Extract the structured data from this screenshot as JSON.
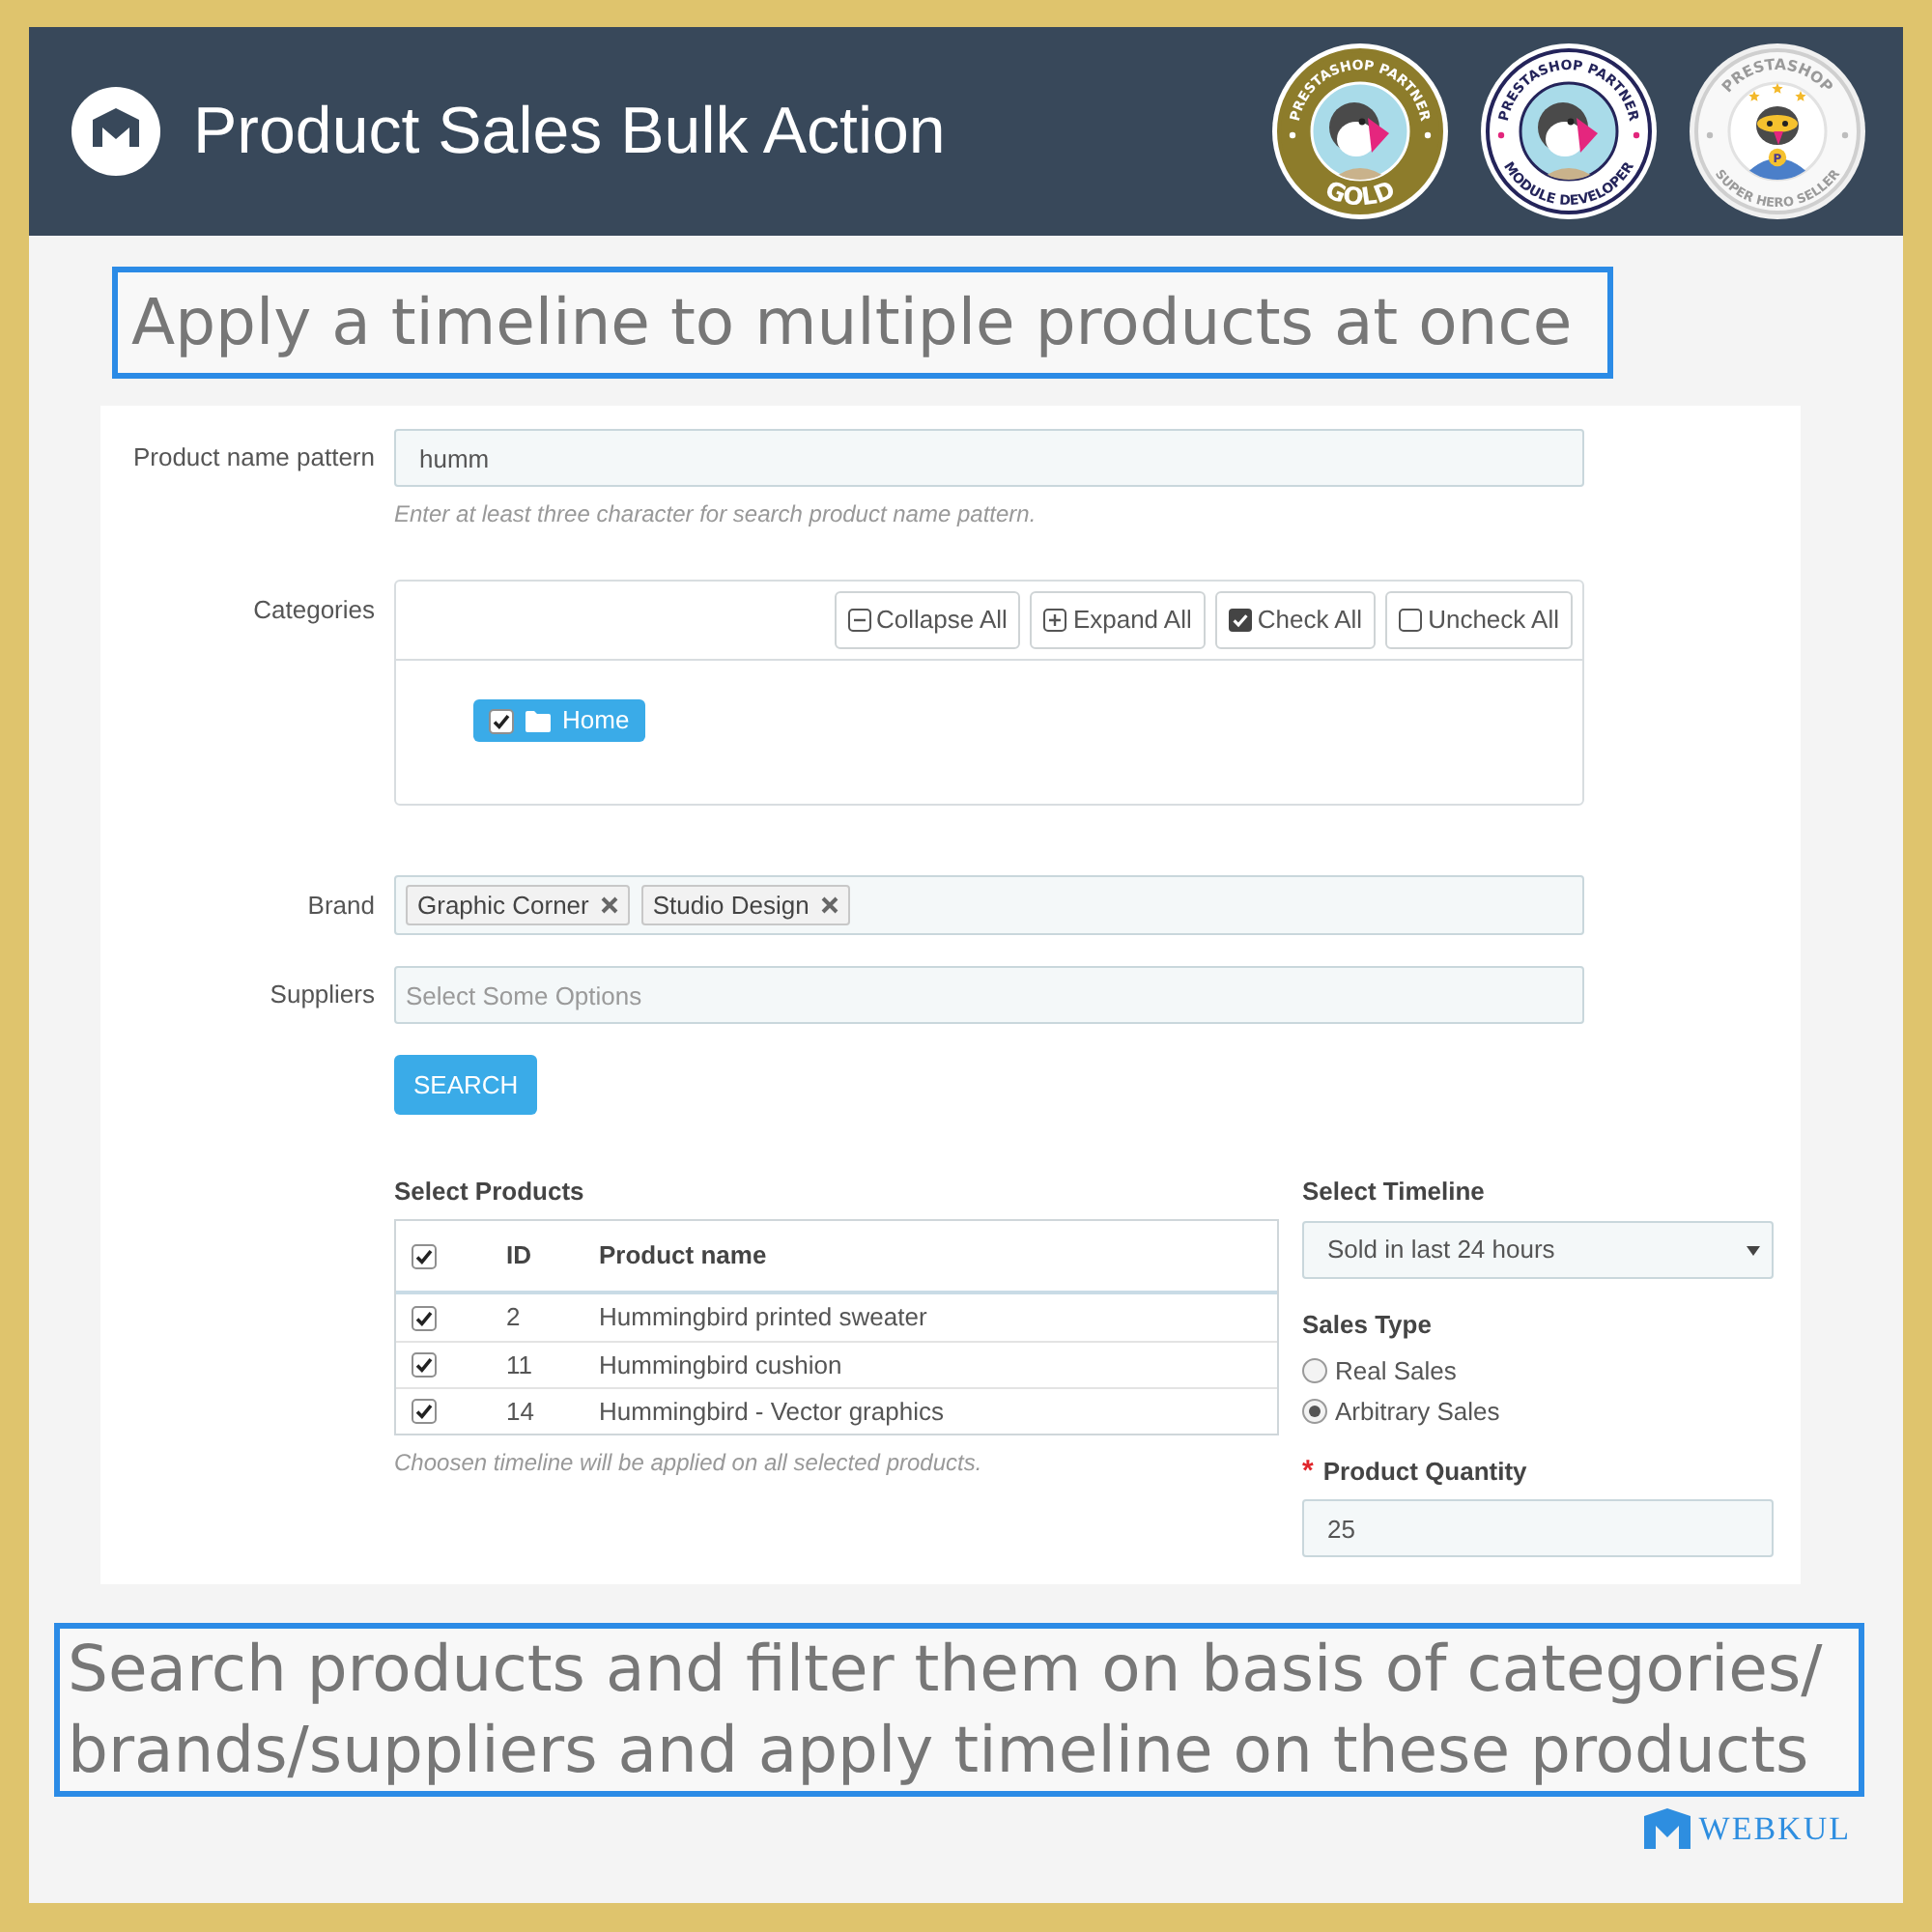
{
  "header": {
    "title": "Product Sales Bulk Action",
    "badges": [
      {
        "kind": "gold",
        "top_text": "PRESTASHOP PARTNER",
        "bottom_text": "GOLD"
      },
      {
        "kind": "developer",
        "top_text": "PRESTASHOP PARTNER",
        "bottom_text": "MODULE DEVELOPER"
      },
      {
        "kind": "hero",
        "top_text": "PRESTASHOP",
        "bottom_text": "SUPER HERO SELLER",
        "emblem": "P"
      }
    ]
  },
  "caption_top": {
    "text": "Apply a timeline to multiple products at once"
  },
  "form": {
    "product_name_pattern": {
      "label": "Product name pattern",
      "value": "humm",
      "help": "Enter at least three character for search product name pattern."
    },
    "categories": {
      "label": "Categories",
      "toolbar": [
        {
          "kind": "collapse",
          "label": "Collapse All"
        },
        {
          "kind": "expand",
          "label": "Expand All"
        },
        {
          "kind": "check",
          "label": "Check All"
        },
        {
          "kind": "uncheck",
          "label": "Uncheck All"
        }
      ],
      "tree": [
        {
          "label": "Home",
          "checked": true
        }
      ]
    },
    "brand": {
      "label": "Brand",
      "tags": [
        "Graphic Corner",
        "Studio Design"
      ]
    },
    "suppliers": {
      "label": "Suppliers",
      "placeholder": "Select Some Options"
    },
    "search_button": {
      "label": "SEARCH"
    },
    "products": {
      "heading": "Select Products",
      "all_checked": true,
      "columns": [
        "ID",
        "Product name"
      ],
      "rows": [
        {
          "id": "2",
          "name": "Hummingbird printed sweater",
          "checked": true
        },
        {
          "id": "11",
          "name": "Hummingbird cushion",
          "checked": true
        },
        {
          "id": "14",
          "name": "Hummingbird - Vector graphics",
          "checked": true
        }
      ],
      "note": "Choosen timeline will be applied on all selected products."
    },
    "timeline": {
      "heading": "Select Timeline",
      "value": "Sold in last 24 hours"
    },
    "sales_type": {
      "heading": "Sales Type",
      "options": [
        {
          "label": "Real Sales",
          "selected": false
        },
        {
          "label": "Arbitrary Sales",
          "selected": true
        }
      ]
    },
    "product_quantity": {
      "required_mark": "*",
      "label": "Product Quantity",
      "value": "25"
    }
  },
  "caption_bottom": {
    "lines": [
      "Search products and filter them on basis of categories/",
      "brands/suppliers and apply timeline on these products"
    ]
  },
  "footer_logo": {
    "text": "WEBKUL"
  }
}
